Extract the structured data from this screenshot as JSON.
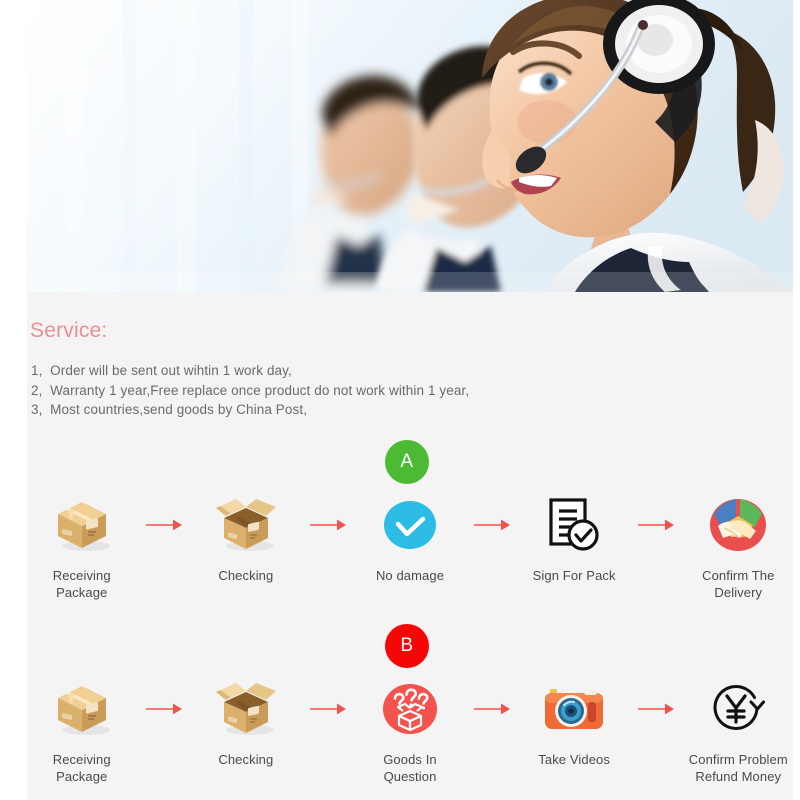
{
  "hero": {
    "alt": "call-center-agents-with-headsets-photo"
  },
  "service": {
    "title": "Service:",
    "lines": [
      "1,  Order will be sent out wihtin 1 work day,",
      "2,  Warranty 1 year,Free replace once product do not work within 1 year,",
      "3,  Most countries,send goods by China Post,"
    ]
  },
  "flows": [
    {
      "badge": "A",
      "badge_color": "#4cba33",
      "steps": [
        {
          "label": "Receiving Package",
          "icon": "closed-box-icon"
        },
        {
          "label": "Checking",
          "icon": "open-box-icon"
        },
        {
          "label": "No damage",
          "icon": "check-circle-icon"
        },
        {
          "label": "Sign For Pack",
          "icon": "document-check-icon"
        },
        {
          "label": "Confirm The Delivery",
          "icon": "handshake-icon"
        }
      ]
    },
    {
      "badge": "B",
      "badge_color": "#f50707",
      "steps": [
        {
          "label": "Receiving Package",
          "icon": "closed-box-icon"
        },
        {
          "label": "Checking",
          "icon": "open-box-icon"
        },
        {
          "label": "Goods In Question",
          "icon": "question-box-icon"
        },
        {
          "label": "Take Videos",
          "icon": "camera-icon"
        },
        {
          "label": "Confirm Problem\nRefund Money",
          "icon": "yen-refund-icon"
        }
      ]
    }
  ],
  "colors": {
    "accent_title": "#e8908f",
    "arrow": "#f4524d",
    "panel_bg": "#f5f4f4",
    "label_text": "#4a4a4a",
    "body_text": "#6a6a6a",
    "badge_a": "#4cba33",
    "badge_b": "#f50707",
    "check_circle": "#2cbce5",
    "question_circle": "#f4524d",
    "camera_body": "#ef6a35"
  }
}
